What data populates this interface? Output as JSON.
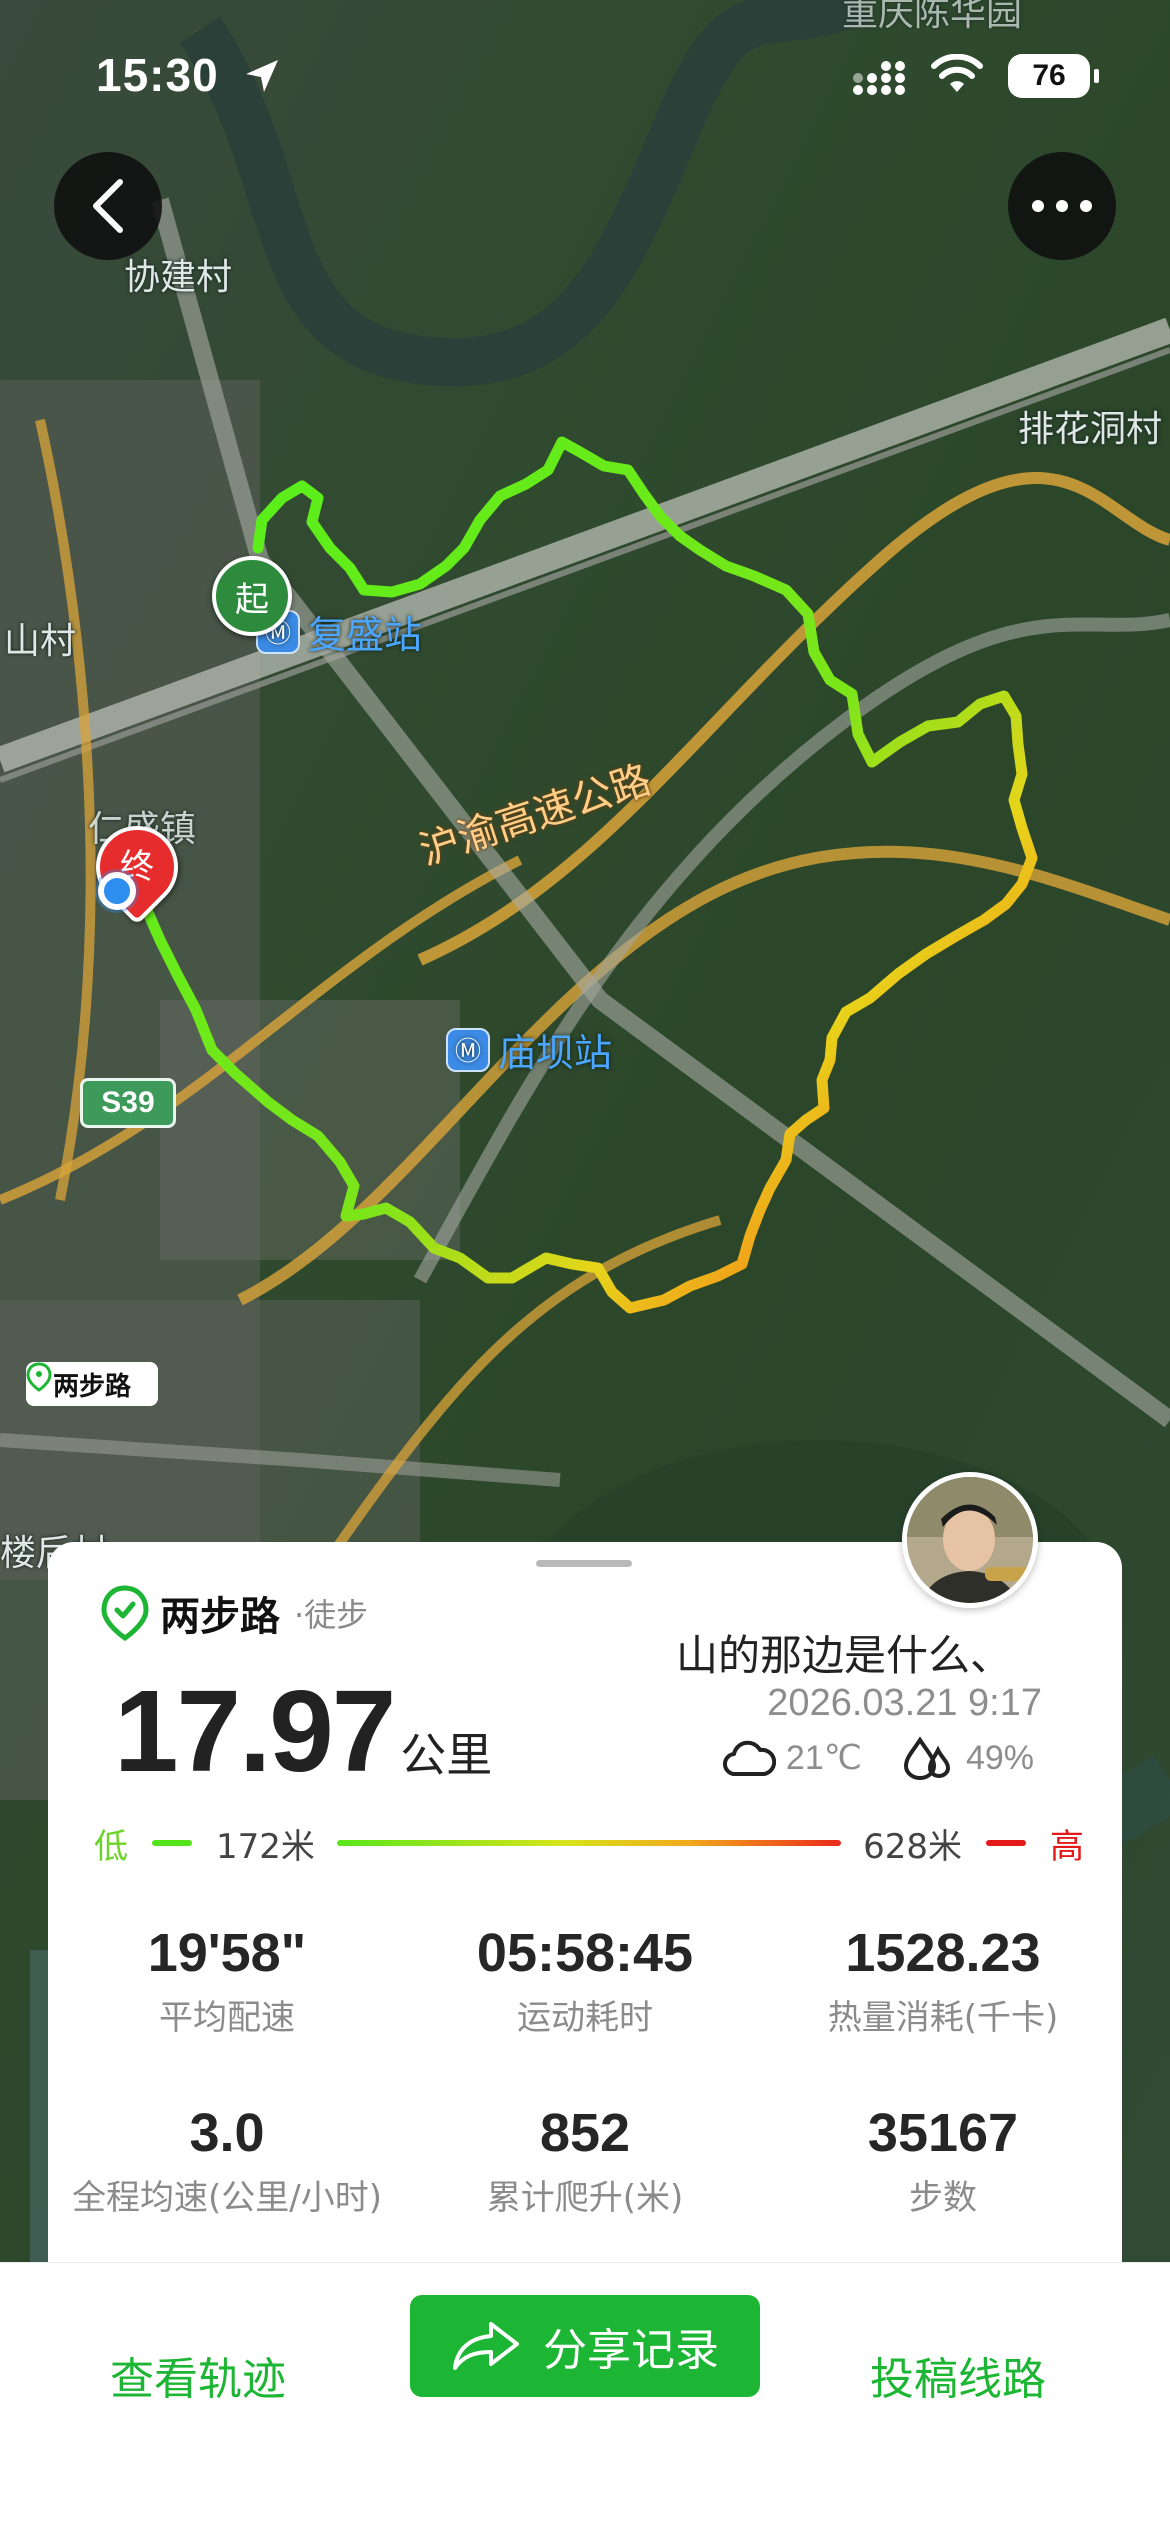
{
  "status_bar": {
    "time": "15:30",
    "battery": "76"
  },
  "map": {
    "labels": {
      "village_top": "协建村",
      "village_left": "山村",
      "town": "仁盛镇",
      "place_right": "排花洞村",
      "park_top": "重庆陈华园",
      "bottom_left": "楼后村"
    },
    "stations": {
      "fusheng": "复盛站",
      "miaoba": "庙坝站"
    },
    "highway": "沪渝高速公路",
    "road_shield": "S39",
    "start_marker": "起",
    "end_marker": "终",
    "logo": "两步路"
  },
  "card": {
    "brand": "两步路",
    "activity": "·徒步",
    "distance": "17.97",
    "distance_unit": "公里",
    "title": "山的那边是什么、",
    "datetime": "2026.03.21 9:17",
    "temperature": "21℃",
    "humidity": "49%",
    "elevation": {
      "low_word": "低",
      "low_value": "172米",
      "high_value": "628米",
      "high_word": "高"
    },
    "stats": [
      {
        "value": "19'58\"",
        "label": "平均配速"
      },
      {
        "value": "05:58:45",
        "label": "运动耗时"
      },
      {
        "value": "1528.23",
        "label": "热量消耗(千卡)"
      },
      {
        "value": "3.0",
        "label": "全程均速(公里/小时)"
      },
      {
        "value": "852",
        "label": "累计爬升(米)"
      },
      {
        "value": "35167",
        "label": "步数"
      }
    ]
  },
  "bottom_bar": {
    "view_track": "查看轨迹",
    "share": "分享记录",
    "submit_route": "投稿线路"
  }
}
